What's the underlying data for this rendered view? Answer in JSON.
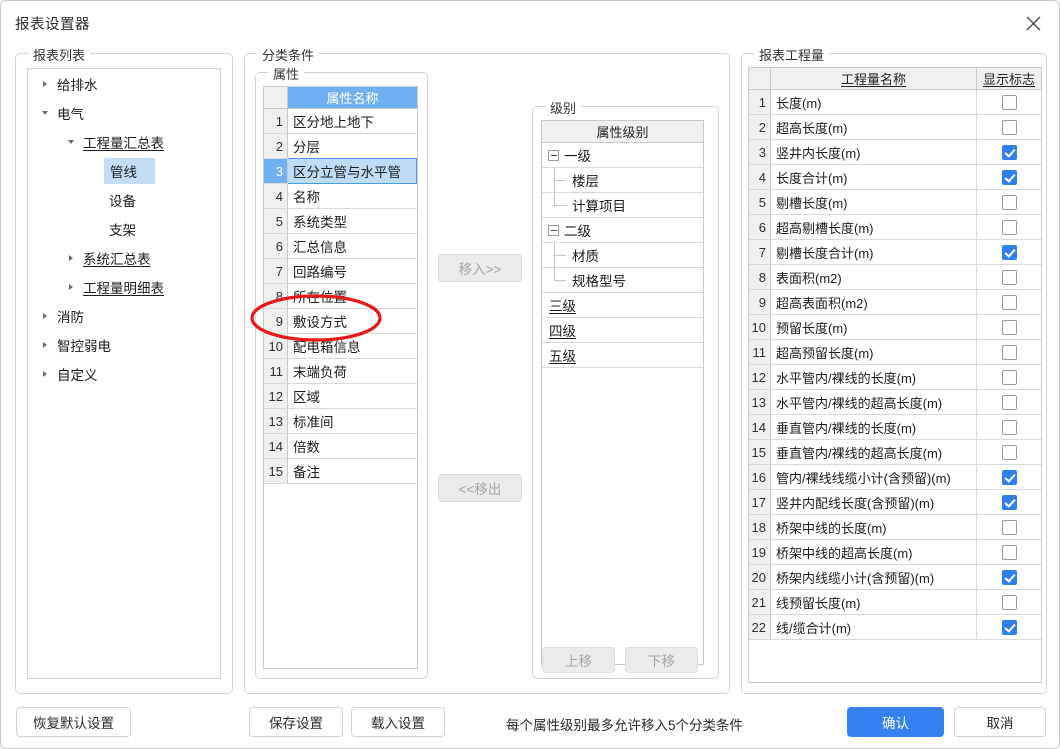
{
  "window": {
    "title": "报表设置器",
    "close_icon": "close-icon"
  },
  "report_list": {
    "group_label": "报表列表",
    "nodes": [
      {
        "label": "给排水",
        "depth": 0,
        "toggle": "collapsed",
        "link": false,
        "selected": false
      },
      {
        "label": "电气",
        "depth": 0,
        "toggle": "expanded",
        "link": false,
        "selected": false
      },
      {
        "label": "工程量汇总表",
        "depth": 1,
        "toggle": "expanded",
        "link": true,
        "selected": false
      },
      {
        "label": "管线",
        "depth": 2,
        "toggle": "none",
        "link": false,
        "selected": true
      },
      {
        "label": "设备",
        "depth": 2,
        "toggle": "none",
        "link": false,
        "selected": false
      },
      {
        "label": "支架",
        "depth": 2,
        "toggle": "none",
        "link": false,
        "selected": false
      },
      {
        "label": "系统汇总表",
        "depth": 1,
        "toggle": "collapsed",
        "link": true,
        "selected": false
      },
      {
        "label": "工程量明细表",
        "depth": 1,
        "toggle": "collapsed",
        "link": true,
        "selected": false
      },
      {
        "label": "消防",
        "depth": 0,
        "toggle": "collapsed",
        "link": false,
        "selected": false
      },
      {
        "label": "智控弱电",
        "depth": 0,
        "toggle": "collapsed",
        "link": false,
        "selected": false
      },
      {
        "label": "自定义",
        "depth": 0,
        "toggle": "collapsed",
        "link": false,
        "selected": false
      }
    ]
  },
  "classify": {
    "group_label": "分类条件",
    "attribute": {
      "group_label": "属性",
      "header_index": "",
      "header_name": "属性名称",
      "rows": [
        {
          "index": "1",
          "name": "区分地上地下",
          "selected": false
        },
        {
          "index": "2",
          "name": "分层",
          "selected": false
        },
        {
          "index": "3",
          "name": "区分立管与水平管",
          "selected": true
        },
        {
          "index": "4",
          "name": "名称",
          "selected": false
        },
        {
          "index": "5",
          "name": "系统类型",
          "selected": false
        },
        {
          "index": "6",
          "name": "汇总信息",
          "selected": false
        },
        {
          "index": "7",
          "name": "回路编号",
          "selected": false
        },
        {
          "index": "8",
          "name": "所在位置",
          "selected": false
        },
        {
          "index": "9",
          "name": "敷设方式",
          "selected": false
        },
        {
          "index": "10",
          "name": "配电箱信息",
          "selected": false
        },
        {
          "index": "11",
          "name": "末端负荷",
          "selected": false
        },
        {
          "index": "12",
          "name": "区域",
          "selected": false
        },
        {
          "index": "13",
          "name": "标准间",
          "selected": false
        },
        {
          "index": "14",
          "name": "倍数",
          "selected": false
        },
        {
          "index": "15",
          "name": "备注",
          "selected": false
        }
      ]
    },
    "move_in_label": "移入>>",
    "move_out_label": "<<移出",
    "level": {
      "group_label": "级别",
      "header": "属性级别",
      "rows": [
        {
          "label": "一级",
          "kind": "parent",
          "expander": "minus",
          "underline": false
        },
        {
          "label": "楼层",
          "kind": "child",
          "expander": "none",
          "underline": false
        },
        {
          "label": "计算项目",
          "kind": "child-last",
          "expander": "none",
          "underline": false
        },
        {
          "label": "二级",
          "kind": "parent",
          "expander": "minus",
          "underline": false
        },
        {
          "label": "材质",
          "kind": "child",
          "expander": "none",
          "underline": false
        },
        {
          "label": "规格型号",
          "kind": "child-last",
          "expander": "none",
          "underline": false
        },
        {
          "label": "三级",
          "kind": "plain",
          "expander": "none",
          "underline": true
        },
        {
          "label": "四级",
          "kind": "plain",
          "expander": "none",
          "underline": true
        },
        {
          "label": "五级",
          "kind": "plain",
          "expander": "none",
          "underline": true
        }
      ],
      "move_up_label": "上移",
      "move_down_label": "下移"
    }
  },
  "quantity": {
    "group_label": "报表工程量",
    "header_index": "",
    "header_name": "工程量名称",
    "header_flag": "显示标志",
    "rows": [
      {
        "index": "1",
        "name": "长度(m)",
        "checked": false
      },
      {
        "index": "2",
        "name": "超高长度(m)",
        "checked": false
      },
      {
        "index": "3",
        "name": "竖井内长度(m)",
        "checked": true
      },
      {
        "index": "4",
        "name": "长度合计(m)",
        "checked": true
      },
      {
        "index": "5",
        "name": "剔槽长度(m)",
        "checked": false
      },
      {
        "index": "6",
        "name": "超高剔槽长度(m)",
        "checked": false
      },
      {
        "index": "7",
        "name": "剔槽长度合计(m)",
        "checked": true
      },
      {
        "index": "8",
        "name": "表面积(m2)",
        "checked": false
      },
      {
        "index": "9",
        "name": "超高表面积(m2)",
        "checked": false
      },
      {
        "index": "10",
        "name": "预留长度(m)",
        "checked": false
      },
      {
        "index": "11",
        "name": "超高预留长度(m)",
        "checked": false
      },
      {
        "index": "12",
        "name": "水平管内/裸线的长度(m)",
        "checked": false
      },
      {
        "index": "13",
        "name": "水平管内/裸线的超高长度(m)",
        "checked": false
      },
      {
        "index": "14",
        "name": "垂直管内/裸线的长度(m)",
        "checked": false
      },
      {
        "index": "15",
        "name": "垂直管内/裸线的超高长度(m)",
        "checked": false
      },
      {
        "index": "16",
        "name": "管内/裸线线缆小计(含预留)(m)",
        "checked": true
      },
      {
        "index": "17",
        "name": "竖井内配线长度(含预留)(m)",
        "checked": true
      },
      {
        "index": "18",
        "name": "桥架中线的长度(m)",
        "checked": false
      },
      {
        "index": "19",
        "name": "桥架中线的超高长度(m)",
        "checked": false
      },
      {
        "index": "20",
        "name": "桥架内线缆小计(含预留)(m)",
        "checked": true
      },
      {
        "index": "21",
        "name": "线预留长度(m)",
        "checked": false
      },
      {
        "index": "22",
        "name": "线/缆合计(m)",
        "checked": true
      }
    ]
  },
  "footer": {
    "restore_label": "恢复默认设置",
    "save_label": "保存设置",
    "load_label": "载入设置",
    "hint": "每个属性级别最多允许移入5个分类条件",
    "ok_label": "确认",
    "cancel_label": "取消"
  },
  "annotation": {
    "type": "red-ellipse",
    "target": "敷设方式",
    "color": "#e8191b"
  },
  "colors": {
    "header_blue": "#6fb0f2",
    "selected_row": "#bfdcf7",
    "tree_selected": "#c4ddf5",
    "checkbox_checked": "#2f80ed",
    "primary_button": "#3581f1",
    "annotation_red": "#e8191b"
  }
}
